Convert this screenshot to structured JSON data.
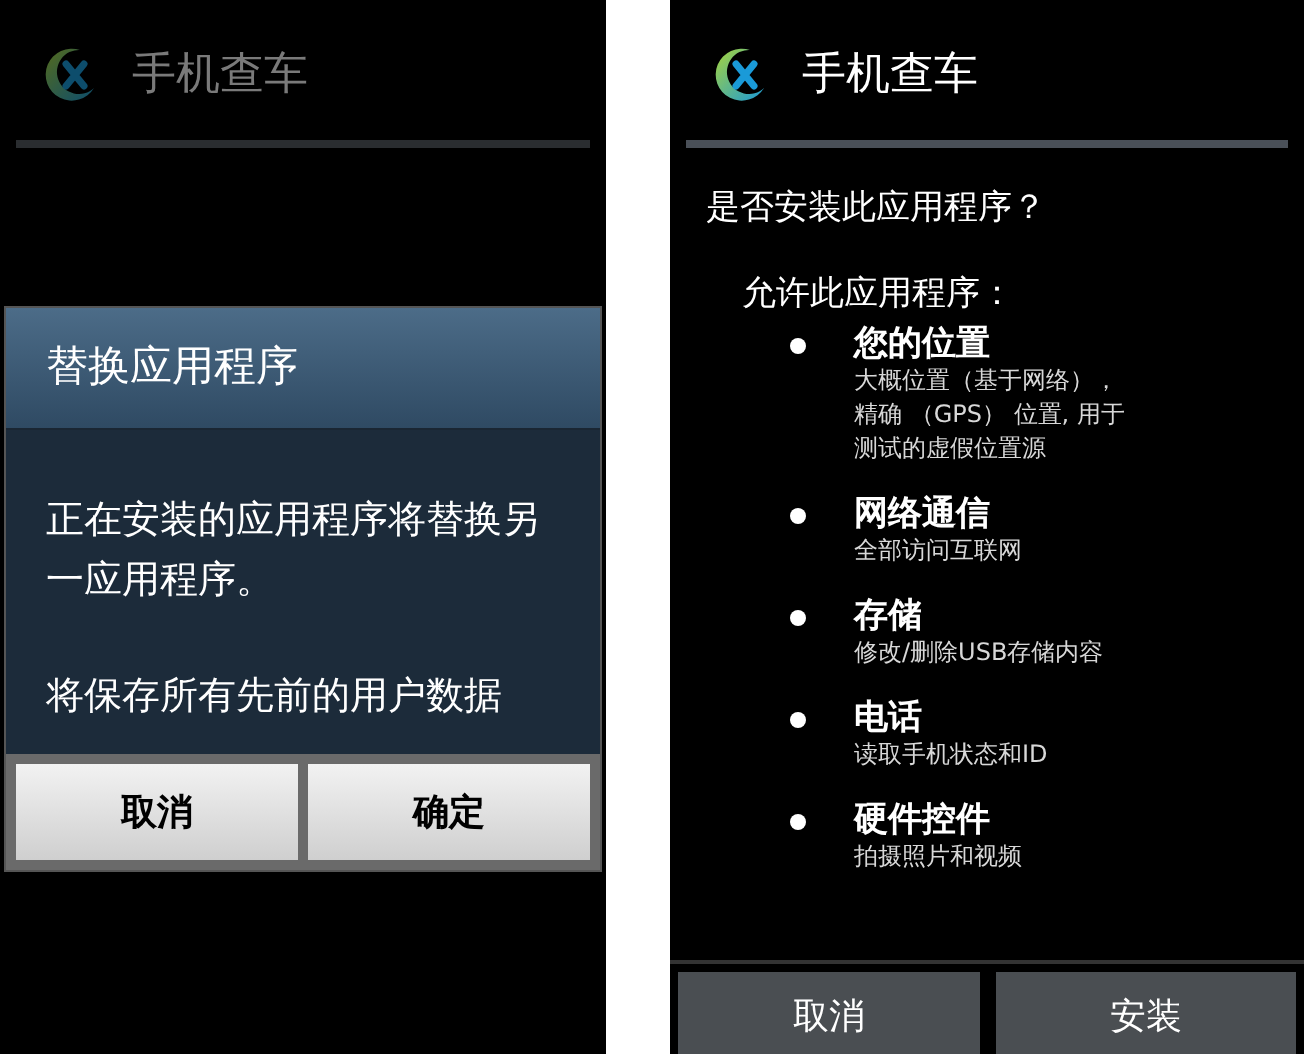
{
  "screens": [
    {
      "kind": "replace_dialog",
      "app_title": "手机查车",
      "dialog": {
        "title": "替换应用程序",
        "paragraphs": [
          "正在安装的应用程序将替换另一应用程序。",
          "将保存所有先前的用户数据"
        ],
        "buttons": [
          "取消",
          "确定"
        ]
      }
    },
    {
      "kind": "install",
      "app_title": "手机查车",
      "question": "是否安装此应用程序？",
      "permissions_heading": "允许此应用程序：",
      "permissions": [
        {
          "title": "您的位置",
          "details": [
            "大概位置（基于网络），",
            "精确 （GPS） 位置, 用于",
            "测试的虚假位置源"
          ]
        },
        {
          "title": "网络通信",
          "details": [
            "全部访问互联网"
          ]
        },
        {
          "title": "存储",
          "details": [
            "修改/删除USB存储内容"
          ]
        },
        {
          "title": "电话",
          "details": [
            "读取手机状态和ID"
          ]
        },
        {
          "title": "硬件控件",
          "details": [
            "拍摄照片和视频"
          ]
        }
      ],
      "buttons": [
        "取消",
        "安装"
      ]
    }
  ]
}
